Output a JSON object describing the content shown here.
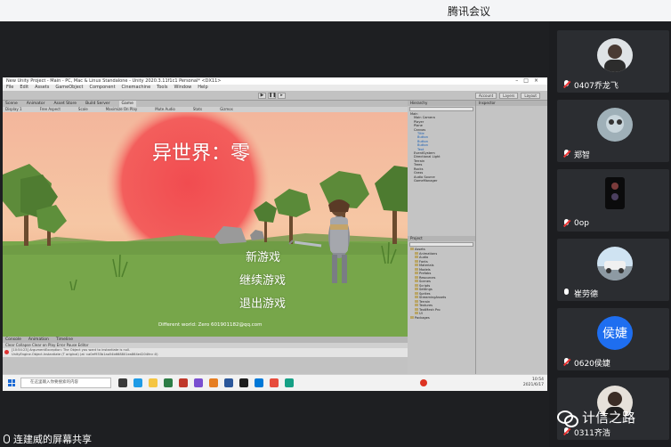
{
  "meeting": {
    "app_title": "腾讯会议",
    "share_label": "连建威的屏幕共享",
    "watermark": "计信之路"
  },
  "participants": [
    {
      "name": "0407乔龙飞",
      "muted": true
    },
    {
      "name": "郑智",
      "muted": true
    },
    {
      "name": "0op",
      "muted": true
    },
    {
      "name": "崔劳德",
      "muted": false
    },
    {
      "name": "0620侯婕",
      "muted": true,
      "avatar_text": "侯婕"
    },
    {
      "name": "0311齐浩",
      "muted": true
    }
  ],
  "unity": {
    "window_title": "New Unity Project - Main - PC, Mac & Linux Standalone - Unity 2020.3.11f1c1 Personal* <DX11>",
    "menu": [
      "File",
      "Edit",
      "Assets",
      "GameObject",
      "Component",
      "Cinemachine",
      "Tools",
      "Window",
      "Help"
    ],
    "toolbar_right": [
      "Account",
      "Layers",
      "Layout"
    ],
    "view_tabs": [
      "Scene",
      "Animator",
      "Asset Store",
      "Build Server",
      "Game"
    ],
    "game_bar": [
      "Display 1",
      "Free Aspect",
      "Scale",
      "Maximize On Play",
      "Mute Audio",
      "Stats",
      "Gizmos"
    ],
    "hierarchy_tab": "Hierarchy",
    "inspector_tab": "Inspector",
    "hierarchy_items": [
      "Main",
      "Main Camera",
      "Player",
      "Plane",
      "Canvas",
      "Title",
      "Button",
      "Button",
      "Button",
      "Text",
      "EventSystem",
      "Directional Light",
      "Terrain",
      "Trees",
      "Rocks",
      "Grass",
      "Audio Source",
      "GameManager"
    ],
    "project_tab": "Project",
    "project_items": [
      "Assets",
      "Animations",
      "Audio",
      "Fonts",
      "Materials",
      "Models",
      "Prefabs",
      "Resources",
      "Scenes",
      "Scripts",
      "Settings",
      "Sprites",
      "StreamingAssets",
      "Terrain",
      "Textures",
      "TextMesh Pro",
      "UI",
      "Packages"
    ],
    "console_tabs": [
      "Console",
      "Animation",
      "Timeline"
    ],
    "console_bar": "Clear   Collapse   Clear on Play   Error Pause   Editor",
    "console_msg_1": "[10:54:23] ArgumentException: The Object you want to instantiate is null.",
    "console_msg_2": "UnityEngine.Object.Instantiate (T original) (at <a0ef933b1aa54b668801ea864e4204fe>:0)"
  },
  "game": {
    "title": "异世界：零",
    "menu_new": "新游戏",
    "menu_continue": "继续游戏",
    "menu_exit": "退出游戏",
    "footer": "Different world: Zero 601901182@qq.com"
  },
  "taskbar": {
    "search_placeholder": "在这里输入你要搜索的内容",
    "time": "10:54",
    "date": "2021/6/17"
  },
  "colors": {
    "sun": "#f2595a",
    "grass": "#7aa84a",
    "sky_top": "#f6b7a0",
    "tencent_blue": "#1e6ef0"
  }
}
